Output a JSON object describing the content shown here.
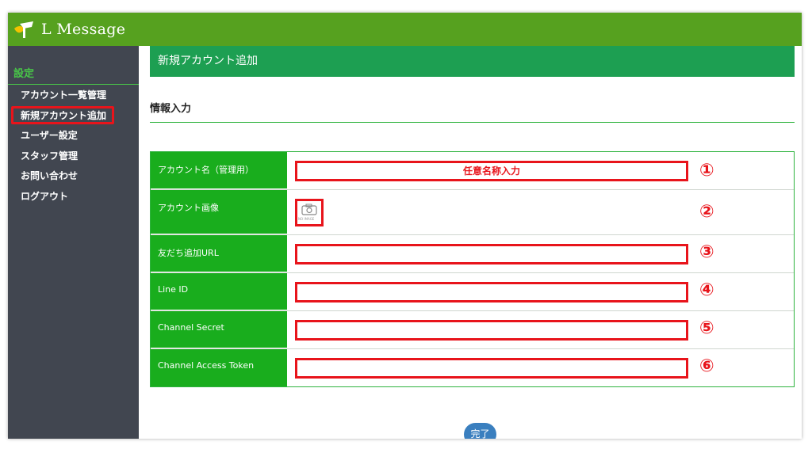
{
  "app": {
    "brand": "L Message",
    "logo_icon": "leaf-flag-logo"
  },
  "sidebar": {
    "title": "設定",
    "items": [
      {
        "label": "アカウント一覧管理"
      },
      {
        "label": "新規アカウント追加",
        "highlighted": true
      },
      {
        "label": "ユーザー設定"
      },
      {
        "label": "スタッフ管理"
      },
      {
        "label": "お問い合わせ"
      },
      {
        "label": "ログアウト"
      }
    ]
  },
  "main": {
    "header": "新規アカウント追加",
    "section_title": "情報入力",
    "fields": [
      {
        "label": "アカウント名（管理用）",
        "value": "任意名称入力",
        "marker": "①"
      },
      {
        "label": "アカウント画像",
        "image_placeholder": "NO IMAGE",
        "marker": "②"
      },
      {
        "label": "友だち追加URL",
        "value": "",
        "marker": "③"
      },
      {
        "label": "Line ID",
        "value": "",
        "marker": "④"
      },
      {
        "label": "Channel Secret",
        "value": "",
        "marker": "⑤"
      },
      {
        "label": "Channel Access Token",
        "value": "",
        "marker": "⑥"
      }
    ],
    "submit_label": "完了"
  },
  "colors": {
    "topbar": "#56a11f",
    "sidebar": "#414650",
    "header": "#1d9f52",
    "label_cell": "#19ad1d",
    "annotation": "#e8141b",
    "button": "#3a7fbf"
  }
}
